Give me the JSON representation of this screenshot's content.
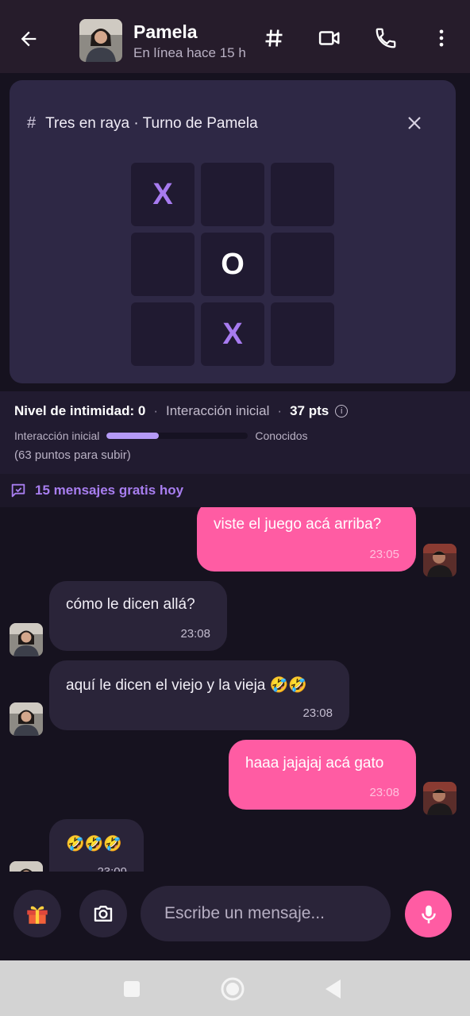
{
  "header": {
    "name": "Pamela",
    "status": "En línea hace 15 h"
  },
  "game": {
    "title": "Tres en raya · Turno de Pamela",
    "board": [
      "X",
      "",
      "",
      "",
      "O",
      "",
      "",
      "X",
      ""
    ]
  },
  "intimacy": {
    "level_label": "Nivel de intimidad: 0",
    "stage": "Interacción inicial",
    "points": "37 pts",
    "progress_from": "Interacción inicial",
    "progress_to": "Conocidos",
    "progress": 0.37,
    "remaining": "(63 puntos para subir)"
  },
  "free_messages": "15 mensajes gratis hoy",
  "messages": [
    {
      "side": "out",
      "text": "viste el juego acá arriba?",
      "time": "23:05"
    },
    {
      "side": "in",
      "text": "cómo le dicen allá?",
      "time": "23:08"
    },
    {
      "side": "in",
      "text": "aquí le dicen el viejo y la vieja 🤣🤣",
      "time": "23:08"
    },
    {
      "side": "out",
      "text": "haaa jajajaj acá gato",
      "time": "23:08"
    },
    {
      "side": "in",
      "text": "🤣🤣🤣",
      "time": "23:09"
    }
  ],
  "composer": {
    "placeholder": "Escribe un mensaje..."
  },
  "colors": {
    "accent_pink": "#ff5ca3",
    "accent_purple": "#a77bf0"
  }
}
